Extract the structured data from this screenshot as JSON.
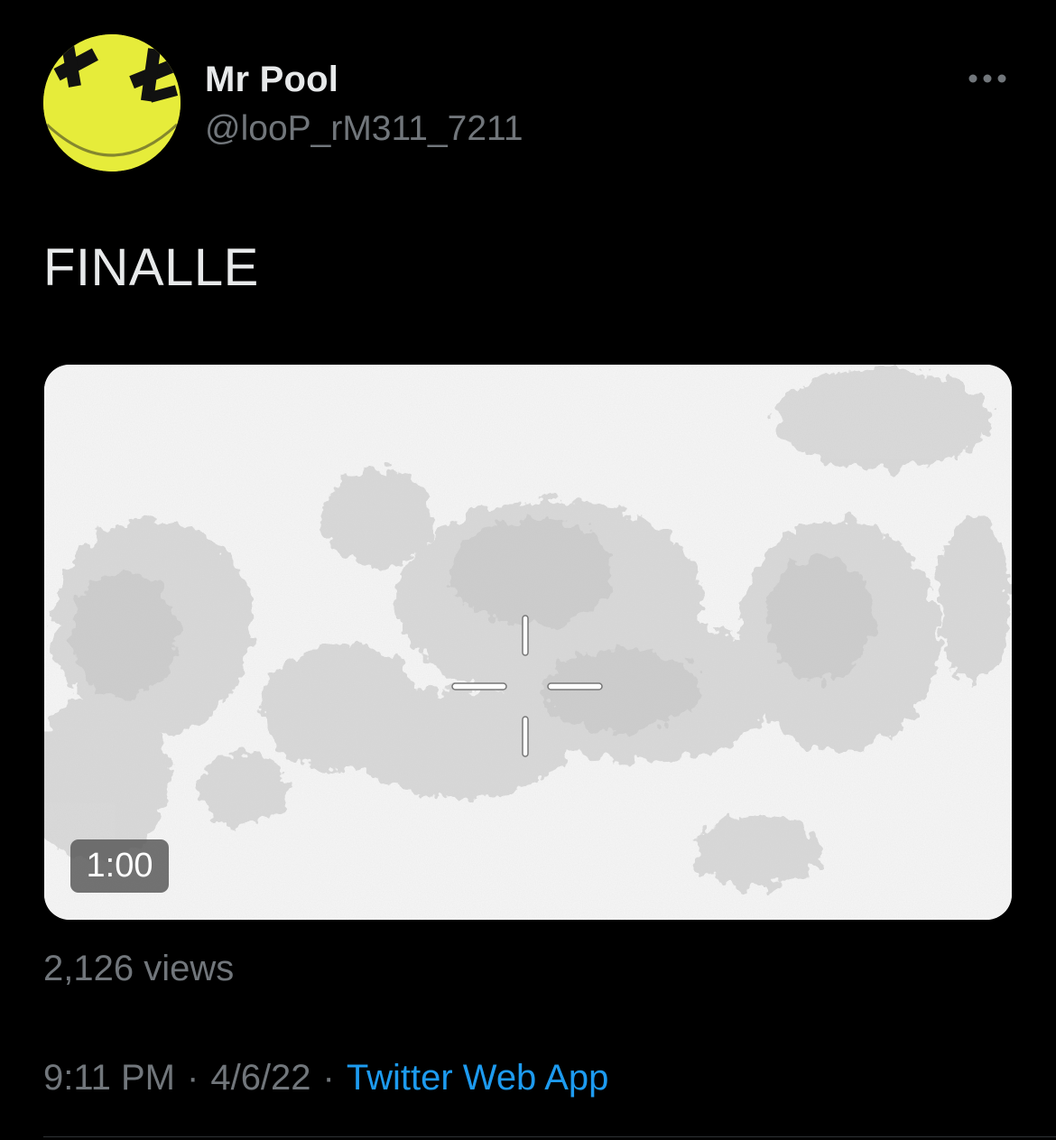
{
  "tweet": {
    "display_name": "Mr Pool",
    "handle": "@looP_rM311_7211",
    "text": "FINALLE",
    "media": {
      "duration": "1:00"
    },
    "views": "2,126 views",
    "time": "9:11 PM",
    "date": "4/6/22",
    "separator": "·",
    "source": "Twitter Web App"
  },
  "icons": {
    "more": "more-horizontal-icon",
    "avatar": "smiley-avatar"
  },
  "colors": {
    "background": "#000000",
    "primary_text": "#e7e9ea",
    "secondary_text": "#71767b",
    "link": "#1d9bf0",
    "avatar_yellow": "#e6ec3a"
  }
}
